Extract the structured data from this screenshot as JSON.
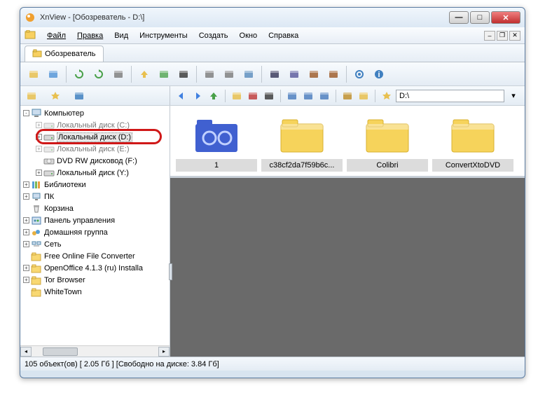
{
  "window": {
    "title": "XnView - [Обозреватель - D:\\]"
  },
  "menu": {
    "file": "Файл",
    "edit": "Правка",
    "view": "Вид",
    "tools": "Инструменты",
    "create": "Создать",
    "window": "Окно",
    "help": "Справка"
  },
  "tab": {
    "browser_label": "Обозреватель"
  },
  "toolbar_main": {
    "icons": [
      "open-icon",
      "browser-icon",
      "refresh-icon",
      "refresh2-icon",
      "settings-icon",
      "folder-up-icon",
      "folder-out-icon",
      "binoculars-icon",
      "print-icon",
      "print2-icon",
      "copy-icon",
      "camera-icon",
      "slideshow-icon",
      "convert-icon",
      "convert2-icon",
      "config-icon",
      "info-icon"
    ]
  },
  "toolbar_nav": {
    "path_value": "D:\\",
    "left_icons": [
      "tree-mode-icon",
      "favorite-star-icon",
      "categories-icon"
    ],
    "right_icons": [
      "back-icon",
      "forward-icon",
      "up-icon",
      "new-folder-icon",
      "cut-icon",
      "delete-icon",
      "view-icons-icon",
      "view-list-icon",
      "sort-icon",
      "filter-icon",
      "favorites-icon",
      "star-icon"
    ]
  },
  "tree": {
    "items": [
      {
        "indent": 0,
        "exp": "-",
        "icon": "computer-icon",
        "label": "Компьютер"
      },
      {
        "indent": 1,
        "exp": "+",
        "icon": "drive-icon",
        "label": "Локальный диск (C:)",
        "dim": true
      },
      {
        "indent": 1,
        "exp": "+",
        "icon": "drive-icon",
        "label": "Локальный диск (D:)",
        "selected": true,
        "highlighted": true
      },
      {
        "indent": 1,
        "exp": "+",
        "icon": "drive-icon",
        "label": "Локальный диск (E:)",
        "dim": true
      },
      {
        "indent": 1,
        "exp": "",
        "icon": "dvd-icon",
        "label": "DVD RW дисковод (F:)"
      },
      {
        "indent": 1,
        "exp": "+",
        "icon": "drive-icon",
        "label": "Локальный диск (Y:)"
      },
      {
        "indent": 0,
        "exp": "+",
        "icon": "libraries-icon",
        "label": "Библиотеки"
      },
      {
        "indent": 0,
        "exp": "+",
        "icon": "pc-icon",
        "label": "ПК"
      },
      {
        "indent": 0,
        "exp": "",
        "icon": "recycle-icon",
        "label": "Корзина"
      },
      {
        "indent": 0,
        "exp": "+",
        "icon": "control-panel-icon",
        "label": "Панель управления"
      },
      {
        "indent": 0,
        "exp": "+",
        "icon": "homegroup-icon",
        "label": "Домашняя группа"
      },
      {
        "indent": 0,
        "exp": "+",
        "icon": "network-icon",
        "label": "Сеть"
      },
      {
        "indent": 0,
        "exp": "",
        "icon": "folder-icon",
        "label": "Free Online File Converter"
      },
      {
        "indent": 0,
        "exp": "+",
        "icon": "folder-icon",
        "label": "OpenOffice 4.1.3 (ru) Installa"
      },
      {
        "indent": 0,
        "exp": "+",
        "icon": "folder-icon",
        "label": "Tor Browser"
      },
      {
        "indent": 0,
        "exp": "",
        "icon": "folder-icon",
        "label": "WhiteTown"
      }
    ]
  },
  "thumbs": {
    "items": [
      {
        "label": "1",
        "special": true
      },
      {
        "label": "c38cf2da7f59b6c..."
      },
      {
        "label": "Colibri"
      },
      {
        "label": "ConvertXtoDVD"
      }
    ]
  },
  "status": {
    "text": "105 объект(ов) [ 2.05 Гб ] [Свободно на диске: 3.84 Гб]"
  }
}
